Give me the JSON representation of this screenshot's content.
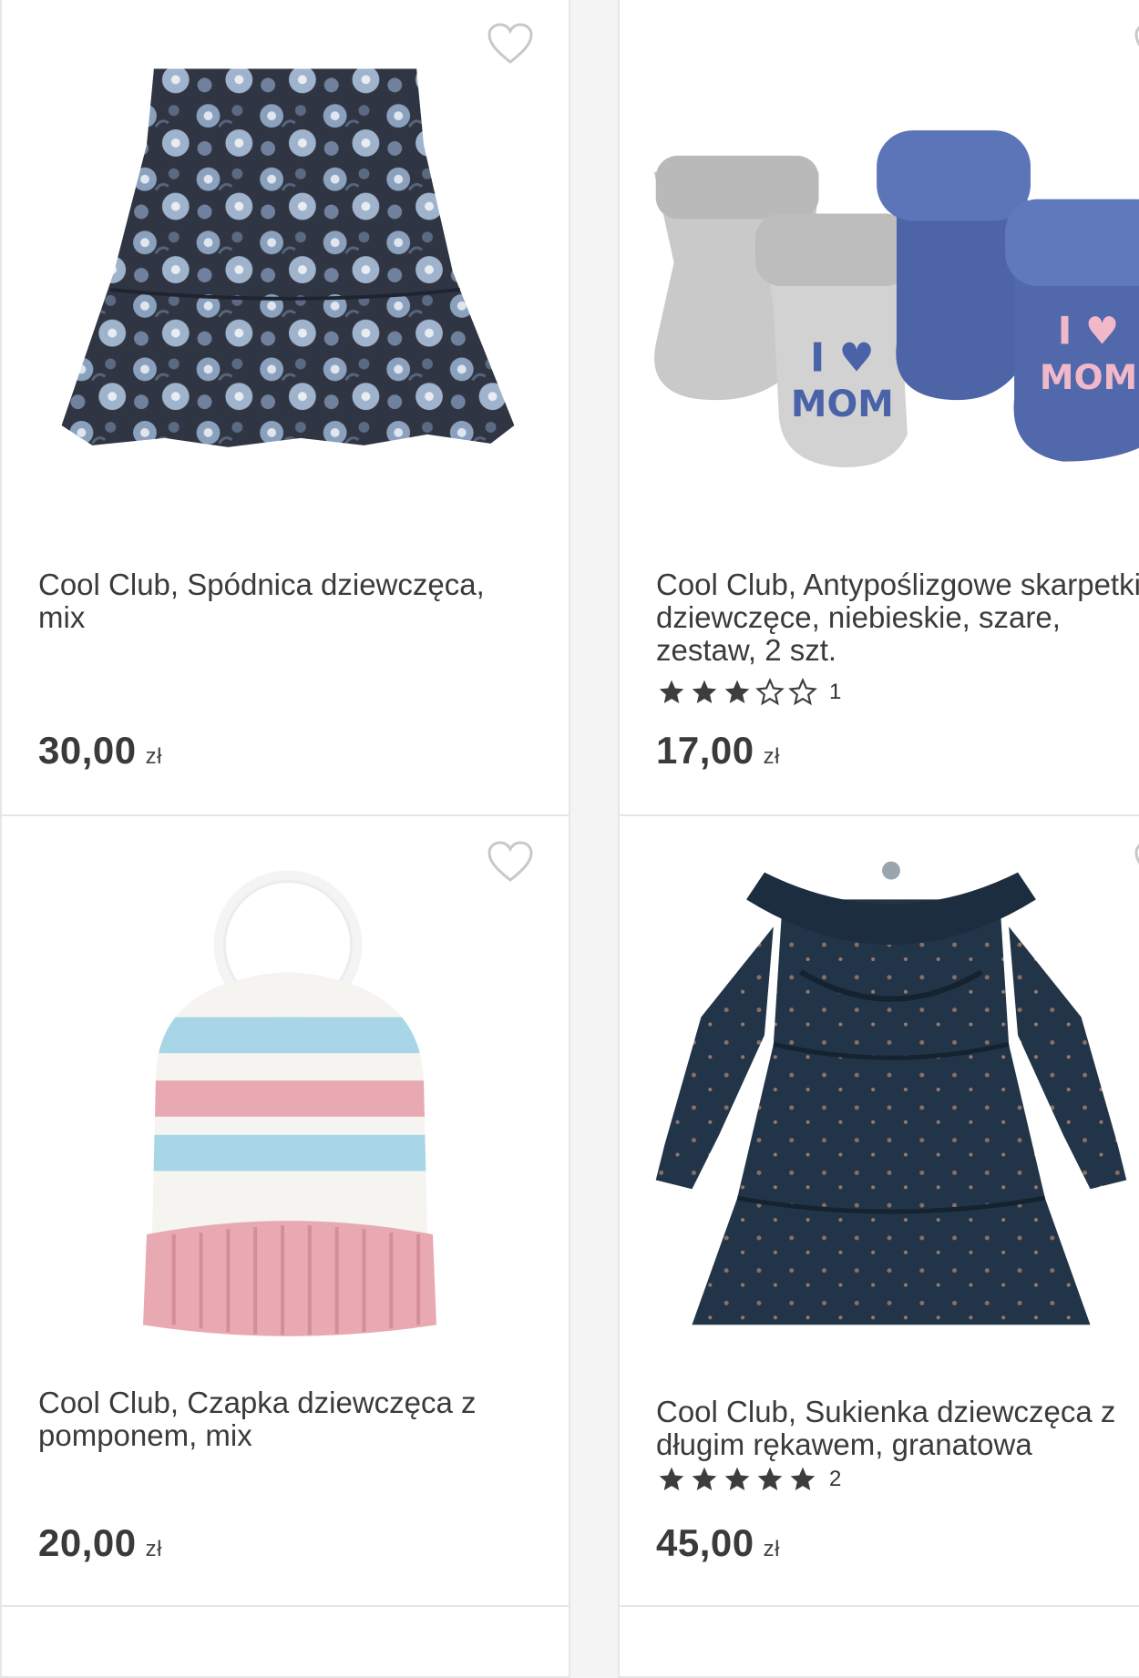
{
  "products": [
    {
      "title": "Cool Club, Spódnica dziewczęca, mix",
      "price": "30,00",
      "currency": "zł",
      "image": "floral-skirt",
      "favorite_icon": "heart-outline-icon"
    },
    {
      "title": "Cool Club, Antypoślizgowe skarpetki dziewczęce, niebieskie, szare, zestaw, 2 szt.",
      "price": "17,00",
      "currency": "zł",
      "rating": 3,
      "rating_max": 5,
      "rating_count": "1",
      "image": "baby-socks-set",
      "favorite_icon": "heart-outline-icon"
    },
    {
      "title": "Cool Club, Czapka dziewczęca z pomponem, mix",
      "price": "20,00",
      "currency": "zł",
      "image": "pompom-beanie",
      "favorite_icon": "heart-outline-icon"
    },
    {
      "title": "Cool Club, Sukienka dziewczęca z długim rękawem, granatowa",
      "price": "45,00",
      "currency": "zł",
      "rating": 5,
      "rating_max": 5,
      "rating_count": "2",
      "image": "navy-dress",
      "favorite_icon": "heart-outline-icon"
    }
  ],
  "colors": {
    "background": "#f4f4f4",
    "card": "#ffffff",
    "border": "#e6e6e6",
    "text": "#3b3b3b",
    "star": "#3d3d3d"
  }
}
